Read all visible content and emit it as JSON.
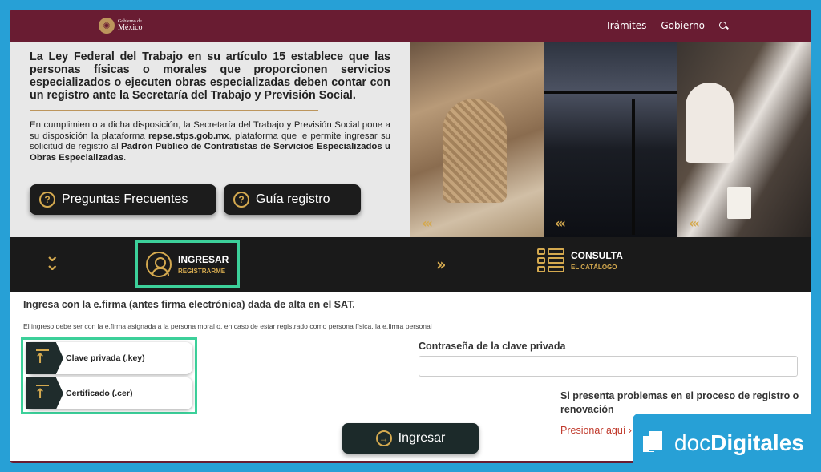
{
  "header": {
    "logo_small": "Gobierno de",
    "logo_big": "México",
    "nav": [
      "Trámites",
      "Gobierno"
    ]
  },
  "hero": {
    "lead_1": "La Ley Federal del Trabajo",
    "lead_2": " en su artículo 15 establece que las personas físicas o morales que proporcionen servicios especializados o ejecuten obras especializadas deben contar con un registro ante la ",
    "lead_3": "Secretaría del Trabajo y Previsión Social",
    "lead_4": ".",
    "body_1": "En cumplimiento a dicha disposición, la Secretaría del Trabajo y Previsión Social pone a su disposición la plataforma ",
    "body_2": "repse.stps.gob.mx",
    "body_3": ", plataforma que le permite ingresar su solicitud de registro al ",
    "body_4": "Padrón Público de Contratistas de Servicios Especializados u Obras Especializadas",
    "body_5": ".",
    "faq_label": "Preguntas Frecuentes",
    "guide_label": "Guía registro",
    "arrows": "‹‹‹"
  },
  "band": {
    "ingresar_title": "INGRESAR",
    "ingresar_sub": "REGISTRARME",
    "consulta_title": "CONSULTA",
    "consulta_sub": "EL CATÁLOGO"
  },
  "form": {
    "title": "Ingresa con la e.firma (antes firma electrónica) dada de alta en el SAT.",
    "note": "El ingreso debe ser con la e.firma asignada a la persona moral o, en caso de estar registrado como persona física, la e.firma personal",
    "key_label": "Clave privada (.key)",
    "cer_label": "Certificado (.cer)",
    "password_label": "Contraseña de la clave privada",
    "password_value": "",
    "help_text": "Si presenta problemas en el proceso de registro o renovación",
    "help_link": "Presionar aquí",
    "submit_label": "Ingresar"
  },
  "watermark": {
    "text_light": "doc",
    "text_bold": "Digitales"
  },
  "colors": {
    "header": "#691c32",
    "gold": "#d4a94f",
    "highlight": "#3cd09a",
    "frame": "#27a0d6",
    "link": "#c0392b"
  }
}
